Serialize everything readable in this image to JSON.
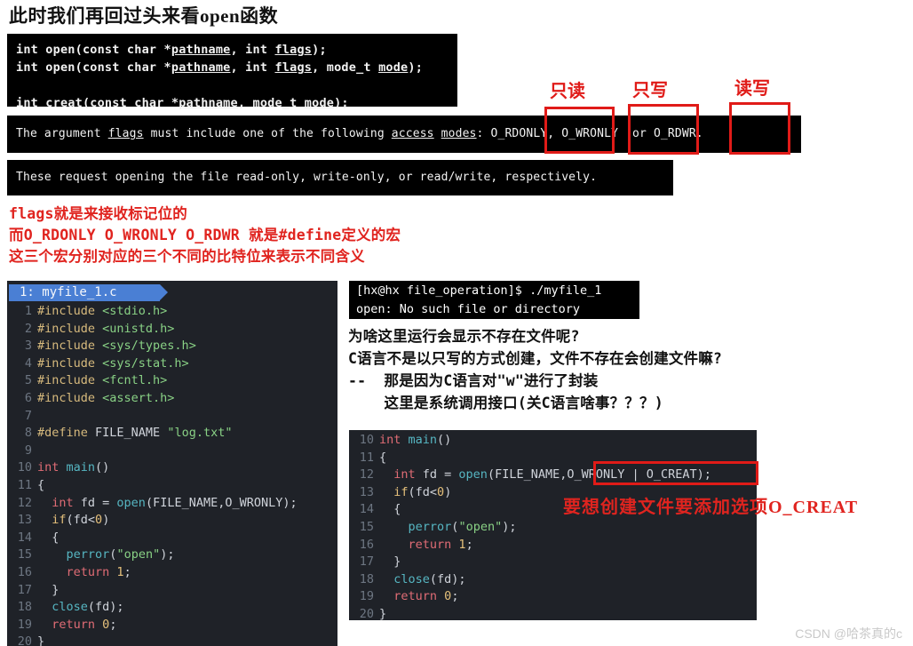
{
  "page_title": "此时我们再回过头来看open函数",
  "man_page": {
    "signatures": [
      {
        "parts": [
          {
            "text": "int open(const char *",
            "u": false
          },
          {
            "text": "pathname",
            "u": true
          },
          {
            "text": ", int ",
            "u": false
          },
          {
            "text": "flags",
            "u": true
          },
          {
            "text": ");",
            "u": false
          }
        ]
      },
      {
        "parts": [
          {
            "text": "int open(const char *",
            "u": false
          },
          {
            "text": "pathname",
            "u": true
          },
          {
            "text": ", int ",
            "u": false
          },
          {
            "text": "flags",
            "u": true
          },
          {
            "text": ", mode_t ",
            "u": false
          },
          {
            "text": "mode",
            "u": true
          },
          {
            "text": ");",
            "u": false
          }
        ]
      },
      {
        "parts": [
          {
            "text": "",
            "u": false
          }
        ]
      },
      {
        "parts": [
          {
            "text": "int creat(const char *",
            "u": false
          },
          {
            "text": "pathname",
            "u": true
          },
          {
            "text": ", mode_t ",
            "u": false
          },
          {
            "text": "mode",
            "u": true
          },
          {
            "text": ");",
            "u": false
          }
        ]
      }
    ],
    "flags_line": {
      "parts": [
        {
          "text": "The argument ",
          "u": false
        },
        {
          "text": "flags",
          "u": true
        },
        {
          "text": " must include one of the following ",
          "u": false
        },
        {
          "text": "access",
          "u": true
        },
        {
          "text": " ",
          "u": false
        },
        {
          "text": "modes",
          "u": true
        },
        {
          "text": ": O_RDONLY, O_WRONLY  or O_RDWR.",
          "u": false
        }
      ]
    },
    "request_line": "These request opening the file read-only, write-only, or read/write, respectively."
  },
  "flag_annotations": [
    {
      "label": "只读",
      "flag": "O_RDONLY"
    },
    {
      "label": "只写",
      "flag": "O_WRONLY"
    },
    {
      "label": "读写",
      "flag": "O_RDWR"
    }
  ],
  "red_note": "flags就是来接收标记位的\n而O_RDONLY O_WRONLY O_RDWR 就是#define定义的宏\n这三个宏分别对应的三个不同的比特位来表示不同含义",
  "editor_left": {
    "tab_label": "1: myfile_1.c",
    "lines": [
      {
        "n": "1",
        "tokens": [
          {
            "t": "#include ",
            "c": "t-pre"
          },
          {
            "t": "<stdio.h>",
            "c": "t-hdr"
          }
        ]
      },
      {
        "n": "2",
        "tokens": [
          {
            "t": "#include ",
            "c": "t-pre"
          },
          {
            "t": "<unistd.h>",
            "c": "t-hdr"
          }
        ]
      },
      {
        "n": "3",
        "tokens": [
          {
            "t": "#include ",
            "c": "t-pre"
          },
          {
            "t": "<sys/types.h>",
            "c": "t-hdr"
          }
        ]
      },
      {
        "n": "4",
        "tokens": [
          {
            "t": "#include ",
            "c": "t-pre"
          },
          {
            "t": "<sys/stat.h>",
            "c": "t-hdr"
          }
        ]
      },
      {
        "n": "5",
        "tokens": [
          {
            "t": "#include ",
            "c": "t-pre"
          },
          {
            "t": "<fcntl.h>",
            "c": "t-hdr"
          }
        ]
      },
      {
        "n": "6",
        "tokens": [
          {
            "t": "#include ",
            "c": "t-pre"
          },
          {
            "t": "<assert.h>",
            "c": "t-hdr"
          }
        ]
      },
      {
        "n": "7",
        "tokens": [
          {
            "t": "",
            "c": "t-plain"
          }
        ]
      },
      {
        "n": "8",
        "tokens": [
          {
            "t": "#define ",
            "c": "t-pre"
          },
          {
            "t": "FILE_NAME ",
            "c": "t-plain"
          },
          {
            "t": "\"log.txt\"",
            "c": "t-hdr"
          }
        ]
      },
      {
        "n": "9",
        "tokens": [
          {
            "t": "",
            "c": "t-plain"
          }
        ]
      },
      {
        "n": "10",
        "tokens": [
          {
            "t": "int ",
            "c": "t-type"
          },
          {
            "t": "main",
            "c": "t-fn"
          },
          {
            "t": "()",
            "c": "t-plain"
          }
        ]
      },
      {
        "n": "11",
        "tokens": [
          {
            "t": "{",
            "c": "t-plain"
          }
        ]
      },
      {
        "n": "12",
        "tokens": [
          {
            "t": "  ",
            "c": "t-plain"
          },
          {
            "t": "int ",
            "c": "t-type"
          },
          {
            "t": "fd = ",
            "c": "t-plain"
          },
          {
            "t": "open",
            "c": "t-fn"
          },
          {
            "t": "(FILE_NAME,O_WRONLY);",
            "c": "t-plain"
          }
        ]
      },
      {
        "n": "13",
        "tokens": [
          {
            "t": "  ",
            "c": "t-plain"
          },
          {
            "t": "if",
            "c": "t-kw"
          },
          {
            "t": "(fd<",
            "c": "t-plain"
          },
          {
            "t": "0",
            "c": "t-num"
          },
          {
            "t": ")",
            "c": "t-plain"
          }
        ]
      },
      {
        "n": "14",
        "tokens": [
          {
            "t": "  {",
            "c": "t-plain"
          }
        ]
      },
      {
        "n": "15",
        "tokens": [
          {
            "t": "    ",
            "c": "t-plain"
          },
          {
            "t": "perror",
            "c": "t-fn"
          },
          {
            "t": "(",
            "c": "t-plain"
          },
          {
            "t": "\"open\"",
            "c": "t-hdr"
          },
          {
            "t": ");",
            "c": "t-plain"
          }
        ]
      },
      {
        "n": "16",
        "tokens": [
          {
            "t": "    ",
            "c": "t-plain"
          },
          {
            "t": "return ",
            "c": "t-type"
          },
          {
            "t": "1",
            "c": "t-num"
          },
          {
            "t": ";",
            "c": "t-plain"
          }
        ]
      },
      {
        "n": "17",
        "tokens": [
          {
            "t": "  }",
            "c": "t-plain"
          }
        ]
      },
      {
        "n": "18",
        "tokens": [
          {
            "t": "  ",
            "c": "t-plain"
          },
          {
            "t": "close",
            "c": "t-fn"
          },
          {
            "t": "(fd);",
            "c": "t-plain"
          }
        ]
      },
      {
        "n": "19",
        "tokens": [
          {
            "t": "  ",
            "c": "t-plain"
          },
          {
            "t": "return ",
            "c": "t-type"
          },
          {
            "t": "0",
            "c": "t-num"
          },
          {
            "t": ";",
            "c": "t-plain"
          }
        ]
      },
      {
        "n": "20",
        "tokens": [
          {
            "t": "}",
            "c": "t-plain"
          }
        ]
      }
    ]
  },
  "terminal": {
    "prompt_line": "[hx@hx file_operation]$ ./myfile_1",
    "output_line": "open: No such file or directory"
  },
  "question_note": "为啥这里运行会显示不存在文件呢?\nC语言不是以只写的方式创建，文件不存在会创建文件嘛?\n--  那是因为C语言对\"w\"进行了封装\n    这里是系统调用接口(关C语言啥事？？？)",
  "editor_right": {
    "lines": [
      {
        "n": "10",
        "tokens": [
          {
            "t": "int ",
            "c": "t-type"
          },
          {
            "t": "main",
            "c": "t-fn"
          },
          {
            "t": "()",
            "c": "t-plain"
          }
        ]
      },
      {
        "n": "11",
        "tokens": [
          {
            "t": "{",
            "c": "t-plain"
          }
        ]
      },
      {
        "n": "12",
        "tokens": [
          {
            "t": "  ",
            "c": "t-plain"
          },
          {
            "t": "int ",
            "c": "t-type"
          },
          {
            "t": "fd = ",
            "c": "t-plain"
          },
          {
            "t": "open",
            "c": "t-fn"
          },
          {
            "t": "(FILE_NAME,O_WRONLY | O_CREAT);",
            "c": "t-plain"
          }
        ]
      },
      {
        "n": "13",
        "tokens": [
          {
            "t": "  ",
            "c": "t-plain"
          },
          {
            "t": "if",
            "c": "t-kw"
          },
          {
            "t": "(fd<",
            "c": "t-plain"
          },
          {
            "t": "0",
            "c": "t-num"
          },
          {
            "t": ")",
            "c": "t-plain"
          }
        ]
      },
      {
        "n": "14",
        "tokens": [
          {
            "t": "  {",
            "c": "t-plain"
          }
        ]
      },
      {
        "n": "15",
        "tokens": [
          {
            "t": "    ",
            "c": "t-plain"
          },
          {
            "t": "perror",
            "c": "t-fn"
          },
          {
            "t": "(",
            "c": "t-plain"
          },
          {
            "t": "\"open\"",
            "c": "t-hdr"
          },
          {
            "t": ");",
            "c": "t-plain"
          }
        ]
      },
      {
        "n": "16",
        "tokens": [
          {
            "t": "    ",
            "c": "t-plain"
          },
          {
            "t": "return ",
            "c": "t-type"
          },
          {
            "t": "1",
            "c": "t-num"
          },
          {
            "t": ";",
            "c": "t-plain"
          }
        ]
      },
      {
        "n": "17",
        "tokens": [
          {
            "t": "  }",
            "c": "t-plain"
          }
        ]
      },
      {
        "n": "18",
        "tokens": [
          {
            "t": "  ",
            "c": "t-plain"
          },
          {
            "t": "close",
            "c": "t-fn"
          },
          {
            "t": "(fd);",
            "c": "t-plain"
          }
        ]
      },
      {
        "n": "19",
        "tokens": [
          {
            "t": "  ",
            "c": "t-plain"
          },
          {
            "t": "return ",
            "c": "t-type"
          },
          {
            "t": "0",
            "c": "t-num"
          },
          {
            "t": ";",
            "c": "t-plain"
          }
        ]
      },
      {
        "n": "20",
        "tokens": [
          {
            "t": "}",
            "c": "t-plain"
          }
        ]
      }
    ]
  },
  "creat_annotation": "要想创建文件要添加选项O_CREAT",
  "watermark": "CSDN @哈茶真的c",
  "colors": {
    "annotation_red": "#e0241f",
    "box_red": "#e01b18",
    "editor_bg": "#1f2228",
    "tab_blue": "#4a7fd4",
    "terminal_bg": "#000000"
  }
}
